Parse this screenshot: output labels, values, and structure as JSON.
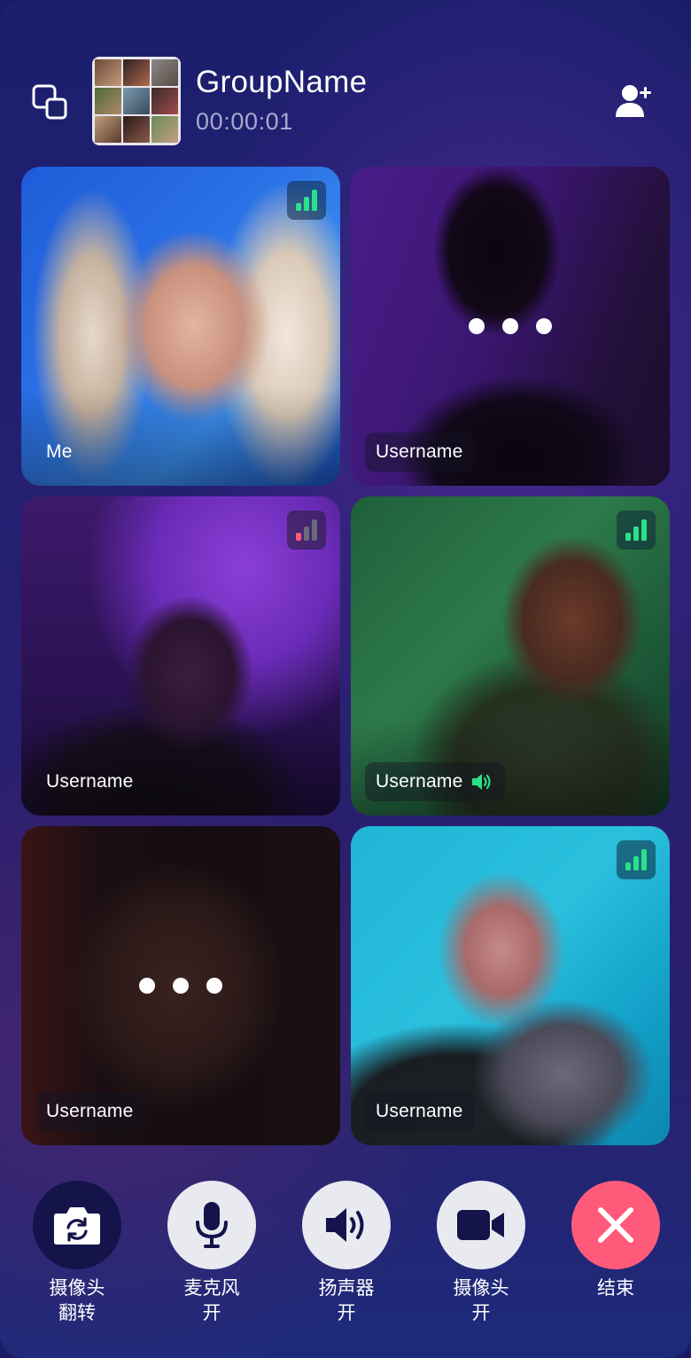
{
  "header": {
    "group_name": "GroupName",
    "call_duration": "00:00:01"
  },
  "participants": [
    {
      "name": "Me",
      "signal": "good",
      "state": "video"
    },
    {
      "name": "Username",
      "signal": "",
      "state": "connecting"
    },
    {
      "name": "Username",
      "signal": "weak",
      "state": "video"
    },
    {
      "name": "Username",
      "signal": "good",
      "state": "video",
      "speaking": true
    },
    {
      "name": "Username",
      "signal": "",
      "state": "connecting"
    },
    {
      "name": "Username",
      "signal": "good",
      "state": "video"
    }
  ],
  "controls": {
    "flip_camera": {
      "line1": "摄像头",
      "line2": "翻转"
    },
    "microphone": {
      "line1": "麦克风",
      "line2": "开"
    },
    "speaker": {
      "line1": "扬声器",
      "line2": "开"
    },
    "camera": {
      "line1": "摄像头",
      "line2": "开"
    },
    "end_call": {
      "line1": "结束"
    }
  },
  "colors": {
    "signal_good": "#2be08a",
    "signal_weak": "#ff5a7a",
    "end_call": "#ff5a7a",
    "control_bg": "#e9e9f0"
  }
}
